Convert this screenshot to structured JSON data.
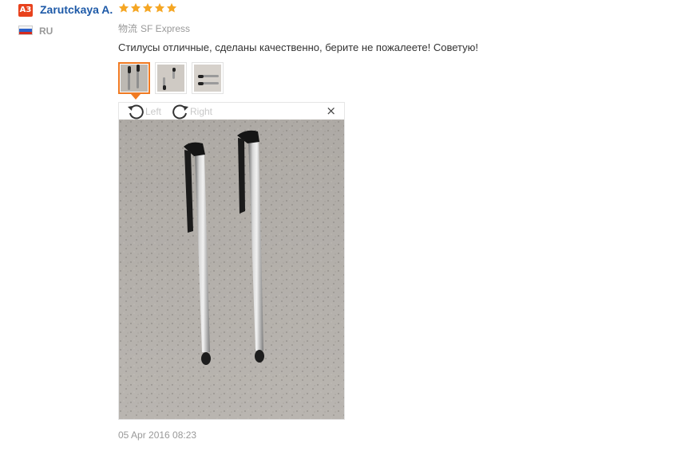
{
  "reviewer": {
    "avatar_initials": "A3",
    "name": "Zarutckaya A.",
    "country_code": "RU",
    "rating": 5,
    "rating_max": 5
  },
  "logistics": {
    "label": "物流",
    "value": "SF Express"
  },
  "review": {
    "text": "Стилусы отличные, сделаны качественно, берите не пожалеете! Советую!",
    "date": "05 Apr 2016 08:23"
  },
  "thumbnails": [
    {
      "name": "photo-1",
      "selected": true
    },
    {
      "name": "photo-2",
      "selected": false
    },
    {
      "name": "photo-3",
      "selected": false
    }
  ],
  "viewer": {
    "rotate_left_label": "Left",
    "rotate_right_label": "Right",
    "close_symbol": "×"
  },
  "colors": {
    "accent": "#f07a22",
    "name_link": "#1e5aa8",
    "star": "#f5a623",
    "badge": "#e8421d",
    "muted_text": "#999999"
  },
  "icons": {
    "star": "star-icon",
    "rotate_left": "rotate-left-icon",
    "rotate_right": "rotate-right-icon",
    "close": "close-icon",
    "flag": "russia-flag-icon"
  }
}
